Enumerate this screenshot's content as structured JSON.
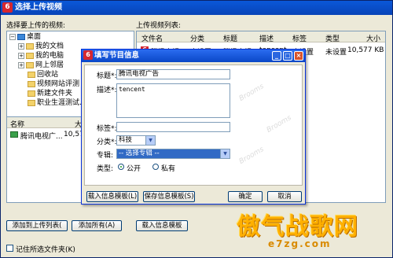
{
  "window": {
    "title": "选择上传视频",
    "app_icon": "6"
  },
  "left_panel": {
    "label": "选择要上传的视频:",
    "tree": [
      {
        "label": "桌面",
        "toggle": "−",
        "icon": "desktop-icon"
      },
      {
        "label": "我的文档",
        "toggle": "+",
        "icon": "folder-icon"
      },
      {
        "label": "我的电脑",
        "toggle": "+",
        "icon": "folder-icon"
      },
      {
        "label": "网上邻居",
        "toggle": "+",
        "icon": "folder-icon"
      },
      {
        "label": "回收站",
        "toggle": "",
        "icon": "folder-icon"
      },
      {
        "label": "视频网站评测",
        "toggle": "",
        "icon": "folder-icon"
      },
      {
        "label": "新建文件夹",
        "toggle": "",
        "icon": "folder-icon"
      },
      {
        "label": "职业生涯测试...",
        "toggle": "",
        "icon": "folder-icon"
      }
    ],
    "list_headers": {
      "name": "名称",
      "size": "大"
    },
    "list_rows": [
      {
        "name": "腾讯电视广...",
        "size": "10,577"
      }
    ]
  },
  "right_panel": {
    "label": "上传视频列表:",
    "headers": [
      "文件名",
      "分类",
      "标题",
      "描述",
      "标签",
      "类型",
      "大小"
    ],
    "rows": [
      {
        "filename": "腾讯电视...",
        "category": "未设置",
        "title": "腾讯电视...",
        "desc": "tencent",
        "tags": "未设置",
        "type": "未设置",
        "size": "10,577 KB"
      }
    ]
  },
  "bottom": {
    "add_to_list": "添加到上传列表(",
    "add_all": "添加所有(A)",
    "load_template": "载入信息模板",
    "remember_folder": "记住所选文件夹(K)"
  },
  "dialog": {
    "title": "填写节目信息",
    "title_label": "标题*:",
    "title_value": "腾讯电视广告",
    "desc_label": "描述*:",
    "desc_value": "tencent",
    "tags_label": "标签*:",
    "tags_value": "",
    "category_label": "分类*:",
    "category_value": "科技",
    "album_label": "专辑:",
    "album_value": "-- 选择专辑 --",
    "type_label": "类型:",
    "type_public": "公开",
    "type_private": "私有",
    "load_btn": "载入信息模板(L)",
    "save_btn": "保存信息模板(S)",
    "ok_btn": "确定",
    "cancel_btn": "取消"
  },
  "watermark": {
    "brand_text": "傲气战歌网",
    "url_text": "e7zg.com",
    "bg_text": "Brooms"
  }
}
